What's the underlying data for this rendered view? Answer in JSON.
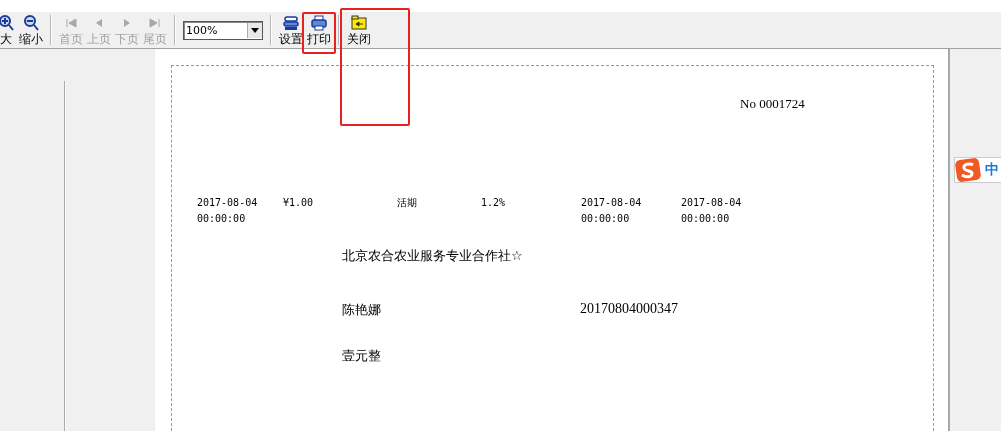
{
  "toolbar": {
    "items": [
      {
        "kind": "button",
        "label": "大",
        "disabled": false,
        "highlighted": false
      },
      {
        "kind": "button",
        "label": "缩小",
        "disabled": false,
        "highlighted": false
      },
      {
        "kind": "separator"
      },
      {
        "kind": "button",
        "label": "首页",
        "disabled": true,
        "highlighted": false
      },
      {
        "kind": "button",
        "label": "上页",
        "disabled": true,
        "highlighted": false
      },
      {
        "kind": "button",
        "label": "下页",
        "disabled": true,
        "highlighted": false
      },
      {
        "kind": "button",
        "label": "尾页",
        "disabled": true,
        "highlighted": false
      },
      {
        "kind": "separator"
      },
      {
        "kind": "select",
        "value": "100%"
      },
      {
        "kind": "separator"
      },
      {
        "kind": "button",
        "label": "设置",
        "disabled": false,
        "highlighted": false
      },
      {
        "kind": "button",
        "label": "打印",
        "disabled": false,
        "highlighted": true
      },
      {
        "kind": "separator"
      },
      {
        "kind": "button",
        "label": "关闭",
        "disabled": false,
        "highlighted": true
      }
    ]
  },
  "document": {
    "number": "No 0001724",
    "row": [
      {
        "lines": [
          "2017-08-04",
          "00:00:00"
        ]
      },
      {
        "lines": [
          "¥1.00"
        ]
      },
      {
        "lines": [
          "活期"
        ]
      },
      {
        "lines": [
          "1.2%"
        ]
      },
      {
        "lines": [
          "2017-08-04",
          "00:00:00"
        ]
      },
      {
        "lines": [
          "2017-08-04",
          "00:00:00"
        ]
      }
    ],
    "company": "北京农合农业服务专业合作社☆",
    "name": "陈艳娜",
    "account": "20170804000347",
    "amount": "壹元整"
  },
  "ime": {
    "label": "中"
  }
}
